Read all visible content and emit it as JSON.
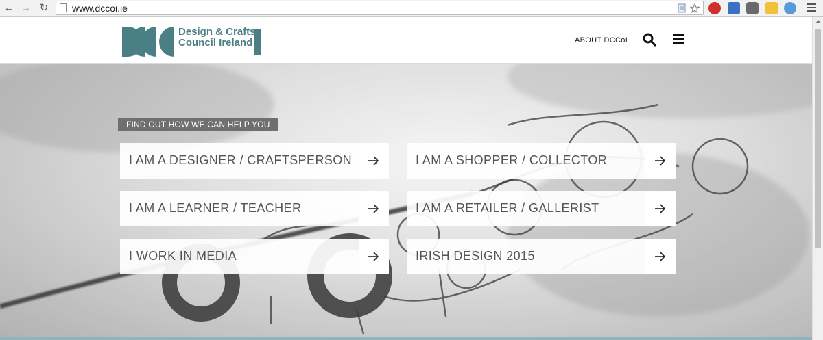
{
  "browser": {
    "url": "www.dccoi.ie"
  },
  "site": {
    "logo": {
      "mark": "DCC",
      "line1": "Design & Crafts",
      "line2": "Council Ireland",
      "color": "#4a7f86"
    },
    "nav": {
      "about": "ABOUT DCCoI",
      "search_icon": "search-icon",
      "menu_icon": "hamburger-menu-icon"
    }
  },
  "hero": {
    "label": "FIND OUT HOW WE CAN HELP YOU",
    "cards": [
      {
        "label": "I AM A DESIGNER / CRAFTSPERSON"
      },
      {
        "label": "I AM A SHOPPER / COLLECTOR"
      },
      {
        "label": "I AM A LEARNER / TEACHER"
      },
      {
        "label": "I AM A RETAILER / GALLERIST"
      },
      {
        "label": "I WORK IN MEDIA"
      },
      {
        "label": "IRISH DESIGN 2015"
      }
    ]
  }
}
